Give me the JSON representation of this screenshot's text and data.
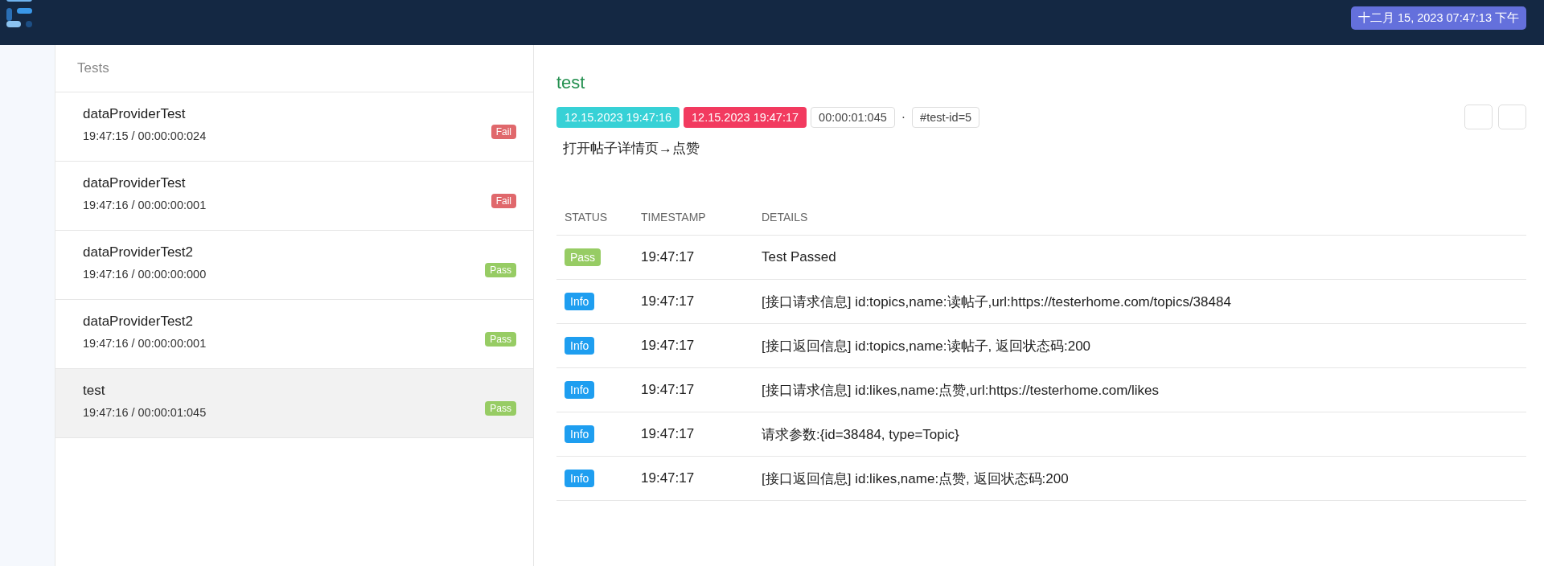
{
  "navbar": {
    "datetime": "十二月 15, 2023 07:47:13 下午"
  },
  "test_list": {
    "title": "Tests",
    "items": [
      {
        "name": "dataProviderTest",
        "time": "19:47:15 / 00:00:00:024",
        "kind": "fail",
        "badge": "Fail",
        "selected": false
      },
      {
        "name": "dataProviderTest",
        "time": "19:47:16 / 00:00:00:001",
        "kind": "fail",
        "badge": "Fail",
        "selected": false
      },
      {
        "name": "dataProviderTest2",
        "time": "19:47:16 / 00:00:00:000",
        "kind": "pass",
        "badge": "Pass",
        "selected": false
      },
      {
        "name": "dataProviderTest2",
        "time": "19:47:16 / 00:00:00:001",
        "kind": "pass",
        "badge": "Pass",
        "selected": false
      },
      {
        "name": "test",
        "time": "19:47:16 / 00:00:01:045",
        "kind": "pass",
        "badge": "Pass",
        "selected": true
      }
    ]
  },
  "detail": {
    "title": "test",
    "start": "12.15.2023 19:47:16",
    "end": "12.15.2023 19:47:17",
    "duration": "00:00:01:045",
    "separator": "·",
    "test_id": "#test-id=5",
    "description": "打开帖子详情页→点赞",
    "log": {
      "columns": [
        "STATUS",
        "TIMESTAMP",
        "DETAILS"
      ],
      "rows": [
        {
          "kind": "pass",
          "badge": "Pass",
          "timestamp": "19:47:17",
          "details": "Test Passed"
        },
        {
          "kind": "info",
          "badge": "Info",
          "timestamp": "19:47:17",
          "details": "[接口请求信息] id:topics,name:读帖子,url:https://testerhome.com/topics/38484"
        },
        {
          "kind": "info",
          "badge": "Info",
          "timestamp": "19:47:17",
          "details": "[接口返回信息] id:topics,name:读帖子, 返回状态码:200"
        },
        {
          "kind": "info",
          "badge": "Info",
          "timestamp": "19:47:17",
          "details": "[接口请求信息] id:likes,name:点赞,url:https://testerhome.com/likes"
        },
        {
          "kind": "info",
          "badge": "Info",
          "timestamp": "19:47:17",
          "details": "请求参数:{id=38484, type=Topic}"
        },
        {
          "kind": "info",
          "badge": "Info",
          "timestamp": "19:47:17",
          "details": "[接口返回信息] id:likes,name:点赞, 返回状态码:200"
        }
      ]
    }
  }
}
